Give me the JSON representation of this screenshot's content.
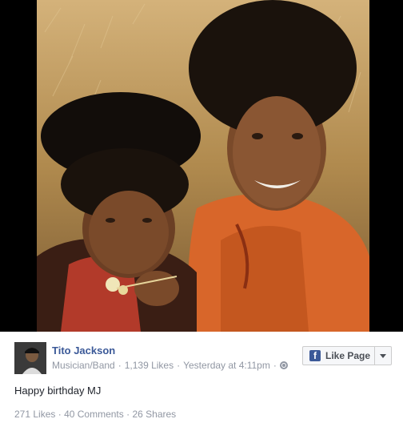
{
  "post": {
    "page_name": "Tito Jackson",
    "category": "Musician/Band",
    "page_likes": "1,139 Likes",
    "timestamp": "Yesterday at 4:11pm",
    "separator": "·",
    "like_button_label": "Like Page",
    "text": "Happy birthday MJ",
    "stats": {
      "likes": "271 Likes",
      "comments": "40 Comments",
      "shares": "26 Shares"
    }
  },
  "icons": {
    "facebook": "facebook-icon",
    "globe": "globe-icon",
    "dropdown": "chevron-down-icon"
  },
  "colors": {
    "link": "#3b5998",
    "meta": "#9197a3",
    "text": "#1d2129"
  }
}
